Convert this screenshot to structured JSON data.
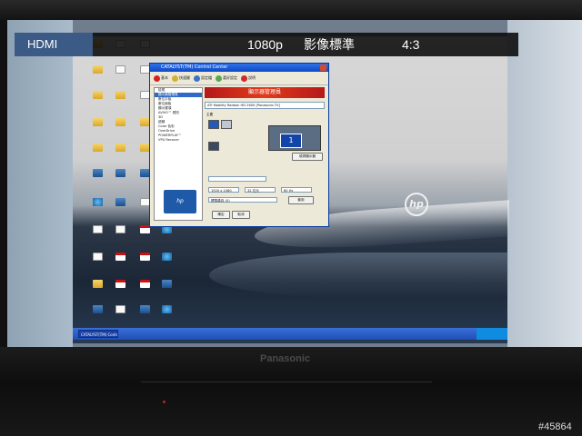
{
  "osd": {
    "source": "HDMI",
    "resolution": "1080p",
    "picture_mode": "影像標準",
    "aspect": "4:3"
  },
  "tv": {
    "brand": "Panasonic"
  },
  "watermark": "#45864",
  "desktop": {
    "wallpaper_logo": "hp"
  },
  "window": {
    "title": "CATALYST(TM) Control Center",
    "toolbar": [
      {
        "label": "基本",
        "icon": "red-circle-icon"
      },
      {
        "label": "快速鍵",
        "icon": "key-icon"
      },
      {
        "label": "設定檔",
        "icon": "profile-icon"
      },
      {
        "label": "喜好設定",
        "icon": "settings-icon"
      },
      {
        "label": "說明",
        "icon": "help-icon"
      }
    ],
    "tree_items": [
      "檢視",
      "顯示器管理員",
      "數位平板",
      "數位面板",
      "顯示選項",
      "AVIVO™ 視訊",
      "3D",
      "超頻",
      "Color 色彩",
      "OverDrive",
      "POWERPLAY™",
      "VPU Recover"
    ],
    "banner_title": "顯示器管理員",
    "display_dropdown": "ATI Mobility Radeon HD 2600 [Panasonic-TV]",
    "primary_label": "主要",
    "monitor_number": "1",
    "detect_button": "偵測顯示器",
    "resolution_value": "1920 x 1080",
    "color_value": "32 位元",
    "refresh_value": "60 Hz",
    "rotation_value": "標準橫向 (0)",
    "apply_button": "套用",
    "ok_button": "確定",
    "cancel_button": "取消"
  },
  "taskbar": {
    "active_task": "CATALYST(TM) Contr..."
  },
  "colors": {
    "osd_source_bg": "#3b5a86",
    "banner_red": "#d2271a",
    "xp_blue": "#1f4fb5"
  }
}
